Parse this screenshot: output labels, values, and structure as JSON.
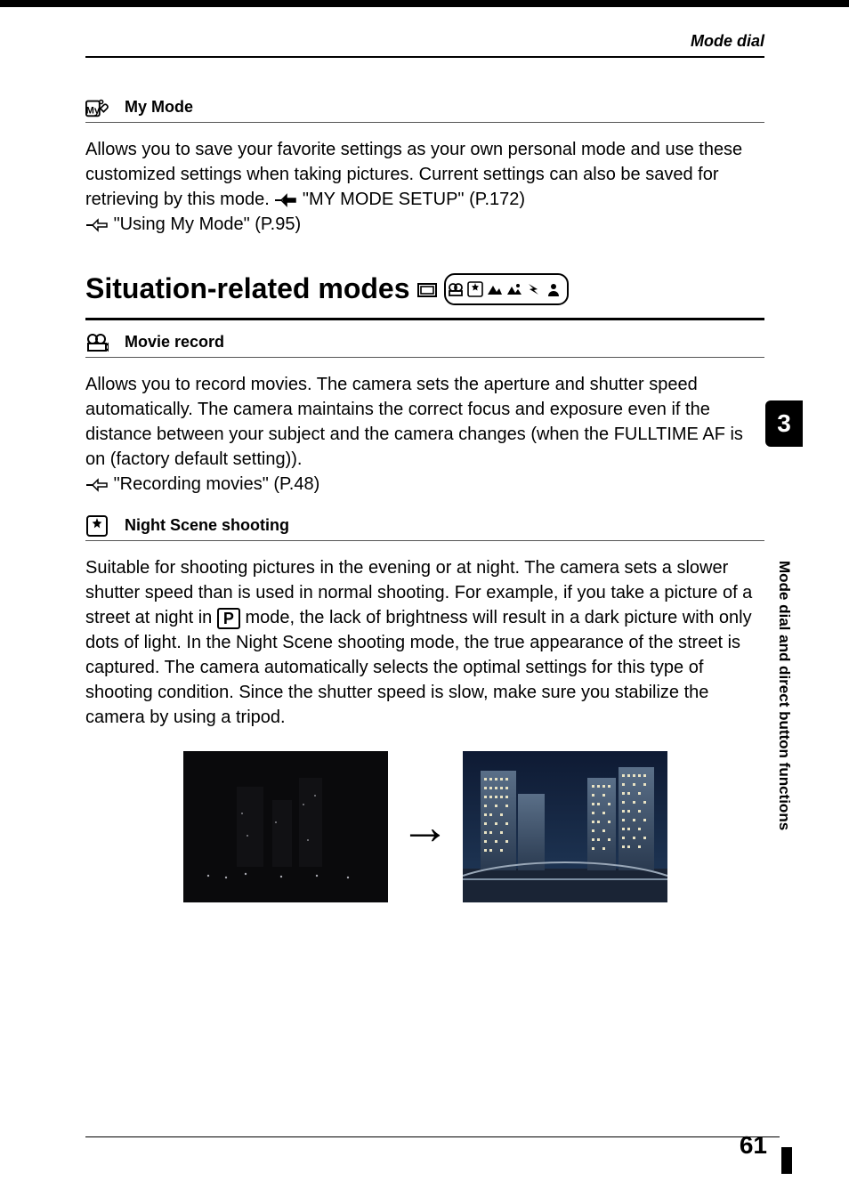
{
  "header": {
    "running_title": "Mode dial"
  },
  "tab": {
    "chapter_number": "3",
    "chapter_title": "Mode dial and direct button functions"
  },
  "mymode": {
    "title": "My Mode",
    "body": "Allows you to save your favorite settings as your own personal mode and use these customized settings when taking pictures. Current settings can also be saved for retrieving by this mode. ",
    "ref1": " \"MY MODE SETUP\" (P.172)",
    "ref2": " \"Using My Mode\" (P.95)"
  },
  "situation": {
    "heading": "Situation-related modes "
  },
  "movie": {
    "title": "Movie record",
    "body": "Allows you to record movies. The camera sets the aperture and shutter speed automatically. The camera maintains the correct focus and exposure even if the distance between your subject and the camera changes (when the FULLTIME AF is on (factory default setting)).",
    "ref": " \"Recording movies\" (P.48)"
  },
  "night": {
    "title": "Night Scene shooting",
    "body_a": "Suitable for shooting pictures in the evening or at night. The camera sets a slower shutter speed than is used in normal shooting. For example, if you take a picture of a street at night in ",
    "body_b": " mode, the lack of brightness will result in a dark picture with only dots of light. In the Night Scene shooting mode, the true appearance of the street is captured. The camera automatically selects the optimal settings for this type of shooting condition. Since the shutter speed is slow, make sure you stabilize the camera by using a tripod."
  },
  "icons": {
    "mymode": "mymode-icon",
    "movie": "movie-icon",
    "night": "night-scene-icon",
    "pointer": "pointer-icon",
    "p_mode": "P",
    "arrow": "→"
  },
  "footer": {
    "page": "61"
  }
}
